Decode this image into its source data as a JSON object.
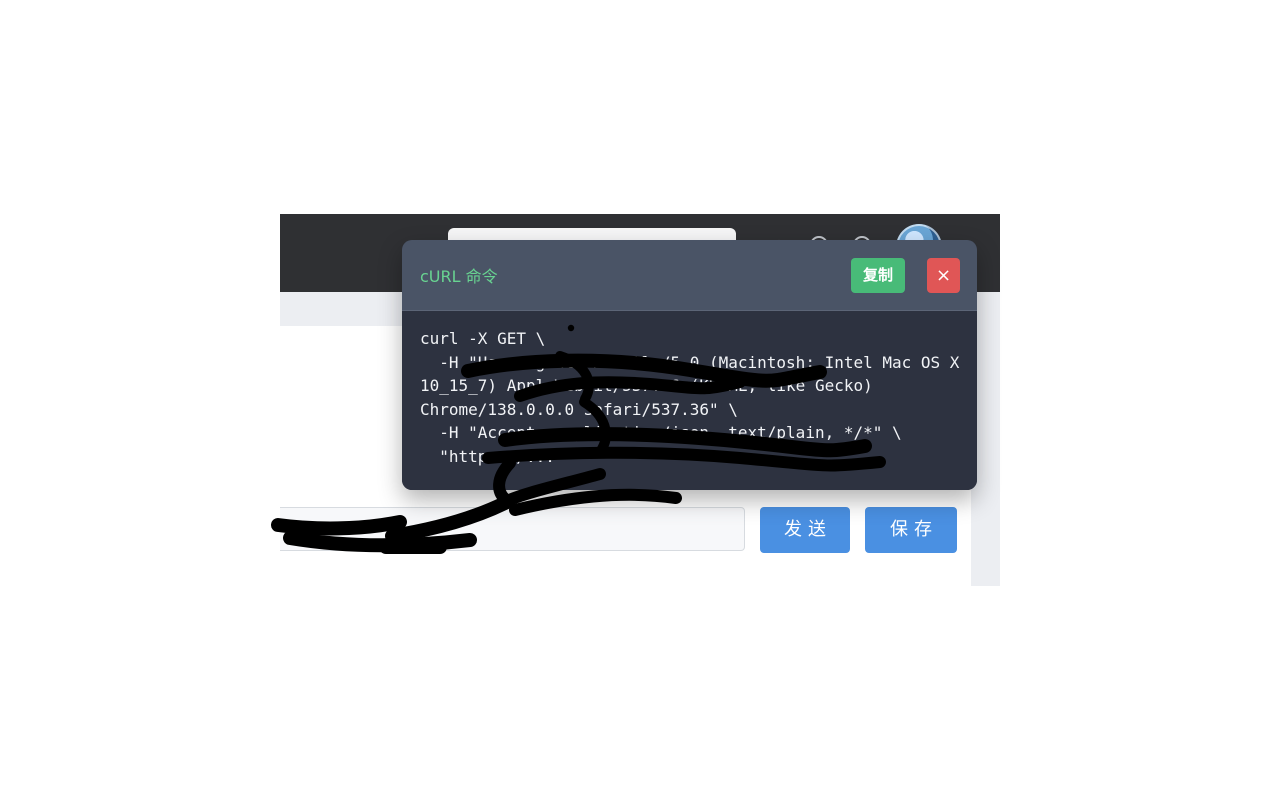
{
  "browser": {
    "avatar_icon": "user-avatar"
  },
  "modal": {
    "title": "cURL 命令",
    "copy_label": "复制",
    "close_label": "×",
    "code": "curl -X GET \\\n  -H \"User-Agent: Mozilla/5.0 (Macintosh; Intel Mac OS X 10_15_7) AppleWebKit/537.36 (KHTML, like Gecko) Chrome/138.0.0.0 Safari/537.36\" \\\n  -H \"Accept: application/json, text/plain, */*\" \\\n  \"https://...\""
  },
  "request": {
    "url_value": "",
    "send_label": "发送",
    "save_label": "保存"
  },
  "colors": {
    "accent_blue": "#4a90e2",
    "copy_green": "#48bb78",
    "close_red": "#e05656",
    "title_green": "#68d391"
  }
}
